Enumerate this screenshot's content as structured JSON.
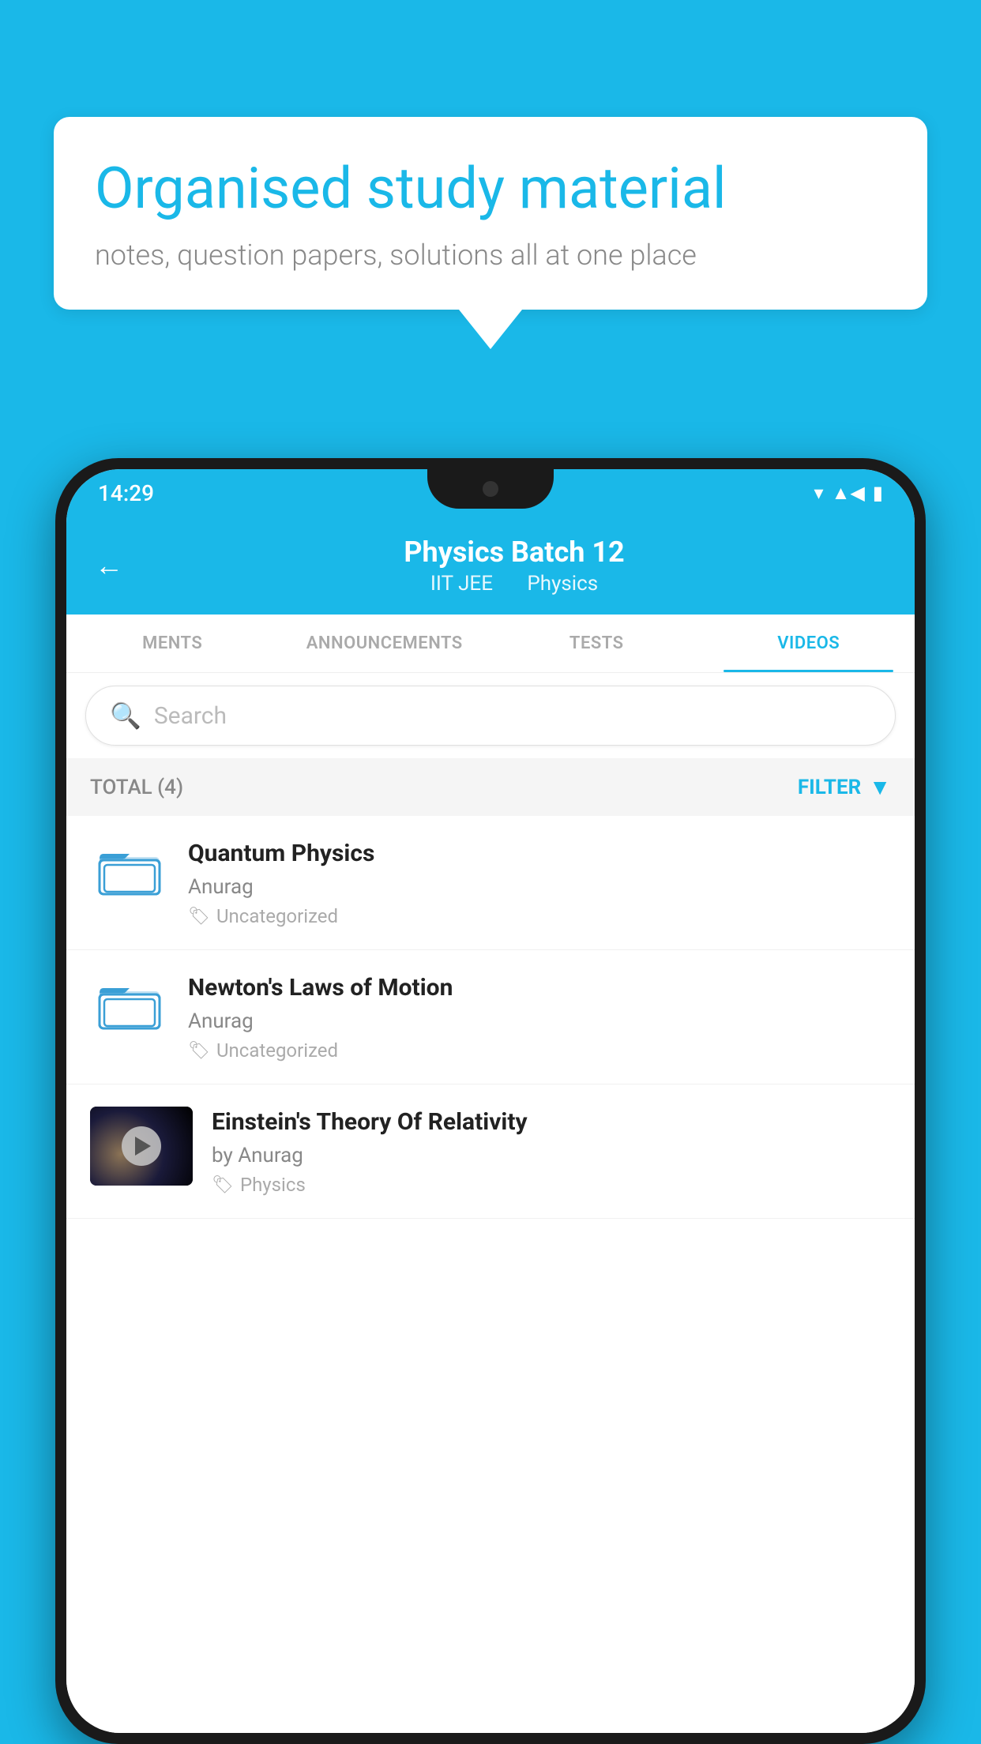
{
  "background_color": "#1ab8e8",
  "hero": {
    "title": "Organised study material",
    "subtitle": "notes, question papers, solutions all at one place"
  },
  "status_bar": {
    "time": "14:29"
  },
  "app_header": {
    "title": "Physics Batch 12",
    "subtitle_part1": "IIT JEE",
    "subtitle_part2": "Physics"
  },
  "tabs": [
    {
      "label": "MENTS",
      "active": false
    },
    {
      "label": "ANNOUNCEMENTS",
      "active": false
    },
    {
      "label": "TESTS",
      "active": false
    },
    {
      "label": "VIDEOS",
      "active": true
    }
  ],
  "search": {
    "placeholder": "Search"
  },
  "filter": {
    "total_label": "TOTAL (4)",
    "filter_label": "FILTER"
  },
  "videos": [
    {
      "title": "Quantum Physics",
      "author": "Anurag",
      "tag": "Uncategorized",
      "has_thumbnail": false
    },
    {
      "title": "Newton's Laws of Motion",
      "author": "Anurag",
      "tag": "Uncategorized",
      "has_thumbnail": false
    },
    {
      "title": "Einstein's Theory Of Relativity",
      "author": "by Anurag",
      "tag": "Physics",
      "has_thumbnail": true
    }
  ]
}
